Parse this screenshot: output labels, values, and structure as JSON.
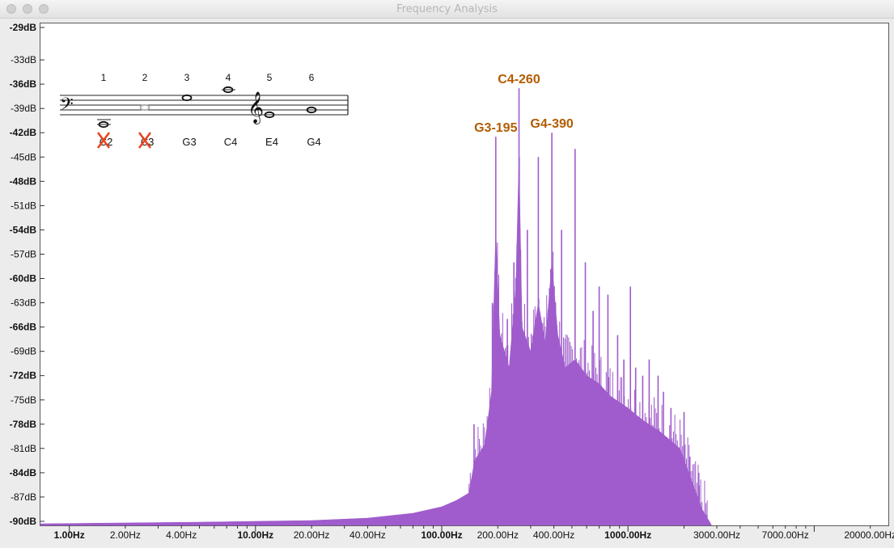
{
  "window": {
    "title": "Frequency Analysis"
  },
  "chart_data": {
    "type": "area",
    "title": "",
    "xlabel": "",
    "ylabel": "",
    "x_scale": "log",
    "xlim": [
      0.7,
      25000
    ],
    "ylim": [
      -90.5,
      -28.5
    ],
    "grid": false,
    "color": "#a05ccc",
    "y_ticks": [
      {
        "value": -29,
        "label": "-29dB",
        "bold": true
      },
      {
        "value": -33,
        "label": "-33dB",
        "bold": false
      },
      {
        "value": -36,
        "label": "-36dB",
        "bold": true
      },
      {
        "value": -39,
        "label": "-39dB",
        "bold": false
      },
      {
        "value": -42,
        "label": "-42dB",
        "bold": true
      },
      {
        "value": -45,
        "label": "-45dB",
        "bold": false
      },
      {
        "value": -48,
        "label": "-48dB",
        "bold": true
      },
      {
        "value": -51,
        "label": "-51dB",
        "bold": false
      },
      {
        "value": -54,
        "label": "-54dB",
        "bold": true
      },
      {
        "value": -57,
        "label": "-57dB",
        "bold": false
      },
      {
        "value": -60,
        "label": "-60dB",
        "bold": true
      },
      {
        "value": -63,
        "label": "-63dB",
        "bold": false
      },
      {
        "value": -66,
        "label": "-66dB",
        "bold": true
      },
      {
        "value": -69,
        "label": "-69dB",
        "bold": false
      },
      {
        "value": -72,
        "label": "-72dB",
        "bold": true
      },
      {
        "value": -75,
        "label": "-75dB",
        "bold": false
      },
      {
        "value": -78,
        "label": "-78dB",
        "bold": true
      },
      {
        "value": -81,
        "label": "-81dB",
        "bold": false
      },
      {
        "value": -84,
        "label": "-84dB",
        "bold": true
      },
      {
        "value": -87,
        "label": "-87dB",
        "bold": false
      },
      {
        "value": -90,
        "label": "-90dB",
        "bold": true
      }
    ],
    "x_ticks": [
      {
        "value": 1,
        "label": "1.00Hz",
        "bold": true
      },
      {
        "value": 2,
        "label": "2.00Hz",
        "bold": false
      },
      {
        "value": 4,
        "label": "4.00Hz",
        "bold": false
      },
      {
        "value": 10,
        "label": "10.00Hz",
        "bold": true
      },
      {
        "value": 20,
        "label": "20.00Hz",
        "bold": false
      },
      {
        "value": 40,
        "label": "40.00Hz",
        "bold": false
      },
      {
        "value": 100,
        "label": "100.00Hz",
        "bold": true
      },
      {
        "value": 200,
        "label": "200.00Hz",
        "bold": false
      },
      {
        "value": 400,
        "label": "400.00Hz",
        "bold": false
      },
      {
        "value": 1000,
        "label": "1000.00Hz",
        "bold": true
      },
      {
        "value": 3000,
        "label": "3000.00Hz",
        "bold": false
      },
      {
        "value": 7000,
        "label": "7000.00Hz",
        "bold": false
      },
      {
        "value": 20000,
        "label": "20000.00Hz",
        "bold": false
      }
    ],
    "envelope": [
      [
        0.7,
        -90.3
      ],
      [
        5,
        -90.1
      ],
      [
        20,
        -89.9
      ],
      [
        40,
        -89.6
      ],
      [
        70,
        -89.0
      ],
      [
        100,
        -88.2
      ],
      [
        120,
        -87.4
      ],
      [
        140,
        -86.5
      ],
      [
        150,
        -82.5
      ],
      [
        170,
        -80.5
      ],
      [
        185,
        -74
      ],
      [
        195,
        -54
      ],
      [
        205,
        -67
      ],
      [
        230,
        -71
      ],
      [
        250,
        -61
      ],
      [
        260,
        -45
      ],
      [
        270,
        -66
      ],
      [
        300,
        -69
      ],
      [
        330,
        -63
      ],
      [
        360,
        -68
      ],
      [
        390,
        -58
      ],
      [
        420,
        -67
      ],
      [
        460,
        -71
      ],
      [
        520,
        -70
      ],
      [
        600,
        -72
      ],
      [
        700,
        -73
      ],
      [
        800,
        -74.5
      ],
      [
        1000,
        -76
      ],
      [
        1200,
        -77.5
      ],
      [
        1500,
        -79
      ],
      [
        1900,
        -81
      ],
      [
        2200,
        -85
      ],
      [
        2500,
        -88.5
      ],
      [
        2800,
        -90.4
      ]
    ],
    "peaks": [
      [
        149,
        -78
      ],
      [
        187,
        -63
      ],
      [
        195,
        -42.5
      ],
      [
        225,
        -65
      ],
      [
        244,
        -58
      ],
      [
        260,
        -36.5
      ],
      [
        288,
        -54
      ],
      [
        330,
        -45
      ],
      [
        390,
        -42
      ],
      [
        440,
        -54
      ],
      [
        520,
        -44
      ],
      [
        590,
        -58
      ],
      [
        650,
        -64
      ],
      [
        700,
        -61
      ],
      [
        780,
        -62
      ],
      [
        880,
        -67
      ],
      [
        950,
        -70
      ],
      [
        1030,
        -61
      ],
      [
        1100,
        -71
      ],
      [
        1200,
        -72
      ],
      [
        1300,
        -70
      ],
      [
        1450,
        -72
      ],
      [
        1550,
        -74
      ],
      [
        1700,
        -76
      ],
      [
        1850,
        -81
      ],
      [
        2000,
        -76.5
      ],
      [
        2150,
        -82
      ],
      [
        2400,
        -84
      ],
      [
        2550,
        -89.5
      ],
      [
        2650,
        -89.2
      ]
    ],
    "annotations": [
      {
        "label": "C4-260",
        "x": 260,
        "y": -36.5,
        "color": "#b35c00"
      },
      {
        "label": "G3-195",
        "x": 195,
        "y": -42.5,
        "color": "#b35c00"
      },
      {
        "label": "G4-390",
        "x": 390,
        "y": -42,
        "color": "#b35c00"
      }
    ]
  },
  "inset": {
    "numbers": [
      "1",
      "2",
      "3",
      "4",
      "5",
      "6"
    ],
    "notes": [
      "C2",
      "C3",
      "G3",
      "C4",
      "E4",
      "G4"
    ],
    "crossed": [
      true,
      true,
      false,
      false,
      false,
      false
    ],
    "cross_color": "#e8431c"
  }
}
